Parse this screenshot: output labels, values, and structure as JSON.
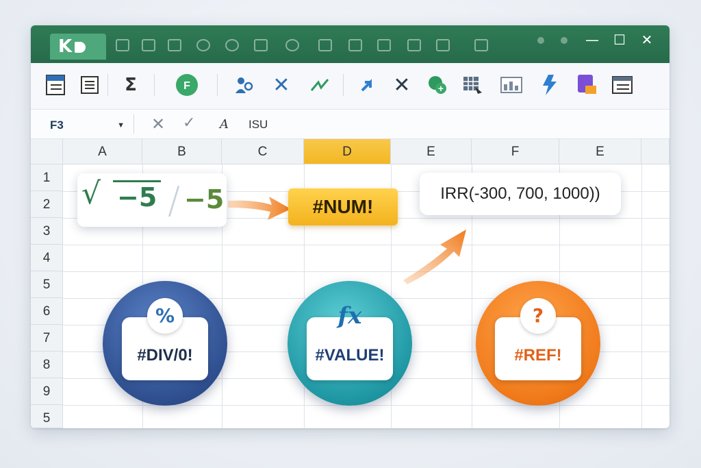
{
  "titlebar": {
    "logo_text": "K",
    "minimize": "—",
    "maximize": "☐",
    "close": "✕"
  },
  "ribbon": {
    "icons": [
      "sheet-icon",
      "document-icon",
      "sum-icon",
      "function-icon",
      "people-icon",
      "cross-icon",
      "trend-icon",
      "upload-icon",
      "close-icon",
      "add-icon",
      "table-icon",
      "chart-icon",
      "flash-icon",
      "form-icon",
      "layout-icon"
    ],
    "function_label": "FƆ"
  },
  "formula_bar": {
    "cell_ref": "F3",
    "fx_label": "A",
    "content": "ISU"
  },
  "columns": [
    "A",
    "B",
    "C",
    "D",
    "E",
    "F",
    "E"
  ],
  "rows": [
    "1",
    "2",
    "3",
    "4",
    "5",
    "6",
    "7",
    "8",
    "9",
    "5"
  ],
  "selected_column": "D",
  "callouts": {
    "sqrt_value": "−5",
    "result_value": "−5",
    "num_error": "#NUM!",
    "irr_formula": "IRR(-300, 700, 1000))"
  },
  "badges": [
    {
      "label": "#DIV/0!",
      "symbol": "%",
      "color": "#2f4f8f"
    },
    {
      "label": "#VALUE!",
      "symbol": "fx",
      "color": "#1f98a4"
    },
    {
      "label": "#REF!",
      "symbol": "?",
      "color": "#f07a1a"
    }
  ]
}
